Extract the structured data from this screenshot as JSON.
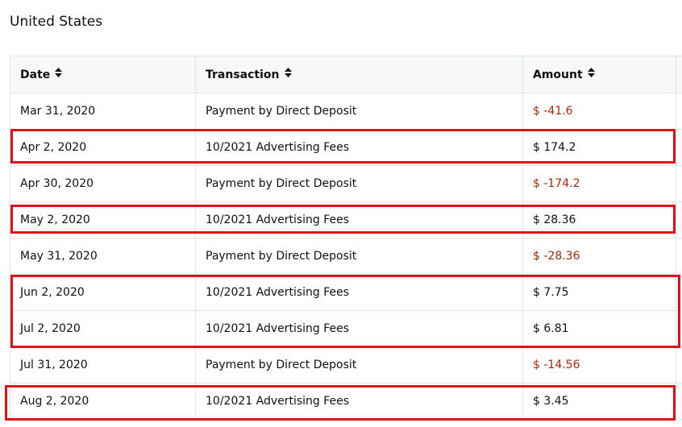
{
  "region": {
    "title": "United States"
  },
  "table": {
    "headers": [
      "Date",
      "Transaction",
      "Amount"
    ],
    "rows": [
      {
        "date": "Mar 31, 2020",
        "transaction": "Payment by Direct Deposit",
        "amount": "$ -41.6",
        "negative": true
      },
      {
        "date": "Apr 2, 2020",
        "transaction": "10/2021 Advertising Fees",
        "amount": "$ 174.2",
        "negative": false
      },
      {
        "date": "Apr 30, 2020",
        "transaction": "Payment by Direct Deposit",
        "amount": "$ -174.2",
        "negative": true
      },
      {
        "date": "May 2, 2020",
        "transaction": "10/2021 Advertising Fees",
        "amount": "$ 28.36",
        "negative": false
      },
      {
        "date": "May 31, 2020",
        "transaction": "Payment by Direct Deposit",
        "amount": "$ -28.36",
        "negative": true
      },
      {
        "date": "Jun 2, 2020",
        "transaction": "10/2021 Advertising Fees",
        "amount": "$ 7.75",
        "negative": false
      },
      {
        "date": "Jul 2, 2020",
        "transaction": "10/2021 Advertising Fees",
        "amount": "$ 6.81",
        "negative": false
      },
      {
        "date": "Jul 31, 2020",
        "transaction": "Payment by Direct Deposit",
        "amount": "$ -14.56",
        "negative": true
      },
      {
        "date": "Aug 2, 2020",
        "transaction": "10/2021 Advertising Fees",
        "amount": "$ 3.45",
        "negative": false
      }
    ]
  },
  "colors": {
    "negative": "#b12704",
    "highlight": "#e3101c",
    "header_bg": "#f7f8f8"
  },
  "icons": {
    "sort": "sort-arrows-icon"
  }
}
